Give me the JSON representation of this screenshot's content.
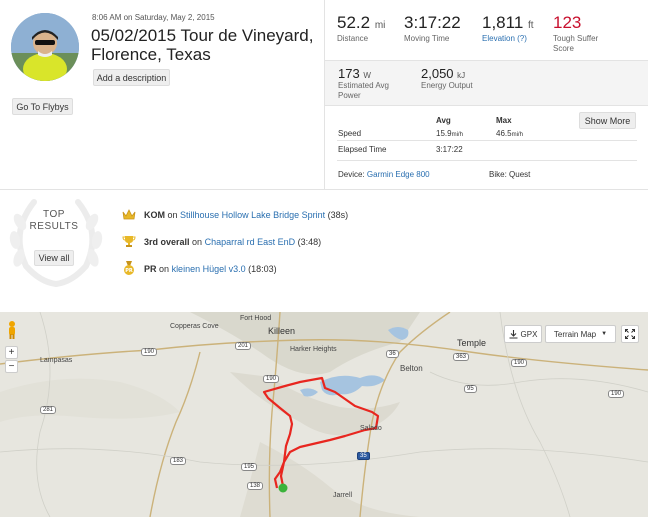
{
  "activity": {
    "datetime": "8:06 AM on Saturday, May 2, 2015",
    "title_line1": "05/02/2015 Tour de Vineyard,",
    "title_line2": "Florence, Texas",
    "add_description": "Add a description",
    "go_to_flybys": "Go To Flybys"
  },
  "stats": {
    "distance": {
      "value": "52.2",
      "unit": "mi",
      "label": "Distance"
    },
    "moving_time": {
      "value": "3:17:22",
      "label": "Moving Time"
    },
    "elevation": {
      "value": "1,811",
      "unit": "ft",
      "label": "Elevation (?)"
    },
    "suffer": {
      "value": "123",
      "label_line1": "Tough Suffer",
      "label_line2": "Score"
    },
    "avg_power": {
      "value": "173",
      "unit": "W",
      "label_line1": "Estimated Avg",
      "label_line2": "Power"
    },
    "energy": {
      "value": "2,050",
      "unit": "kJ",
      "label": "Energy Output"
    },
    "show_more": "Show More"
  },
  "table": {
    "col_avg": "Avg",
    "col_max": "Max",
    "speed_label": "Speed",
    "speed_avg_value": "15.9",
    "speed_avg_unit": "mi/h",
    "speed_max_value": "46.5",
    "speed_max_unit": "mi/h",
    "elapsed_label": "Elapsed Time",
    "elapsed_value": "3:17:22"
  },
  "device": {
    "label": "Device:",
    "value": "Garmin Edge 800",
    "bike_label": "Bike:",
    "bike_value": "Quest"
  },
  "results": {
    "heading_line1": "TOP",
    "heading_line2": "RESULTS",
    "view_all": "View all",
    "items": [
      {
        "bold": "KOM",
        "on": "on",
        "segment": "Stillhouse Hollow Lake Bridge Sprint",
        "time": "(38s)",
        "icon": "crown-icon"
      },
      {
        "bold": "3rd overall",
        "on": "on",
        "segment": "Chaparral rd East EnD",
        "time": "(3:48)",
        "icon": "trophy-icon"
      },
      {
        "bold": "PR",
        "on": "on",
        "segment": "kleinen Hügel v3.0",
        "time": "(18:03)",
        "icon": "medal-icon"
      }
    ]
  },
  "map": {
    "gpx_label": "GPX",
    "terrain_label": "Terrain Map",
    "places": {
      "fort_hood": "Fort Hood",
      "copperas_cove": "Copperas Cove",
      "killeen": "Killeen",
      "harker_heights": "Harker Heights",
      "temple": "Temple",
      "belton": "Belton",
      "lampasas": "Lampasas",
      "salado": "Salado",
      "jarrell": "Jarrell"
    },
    "routes": {
      "r190a": "190",
      "r190b": "190",
      "r281": "281",
      "r183": "183",
      "r195": "195",
      "r138": "138",
      "r201": "201",
      "r363": "363",
      "r190c": "190",
      "r35": "35",
      "r36": "36",
      "r95": "95",
      "r190d": "190",
      "r93": "93"
    },
    "colors": {
      "route": "#e8261f",
      "water": "#a6c4e0",
      "start": "#3bb33b"
    }
  }
}
